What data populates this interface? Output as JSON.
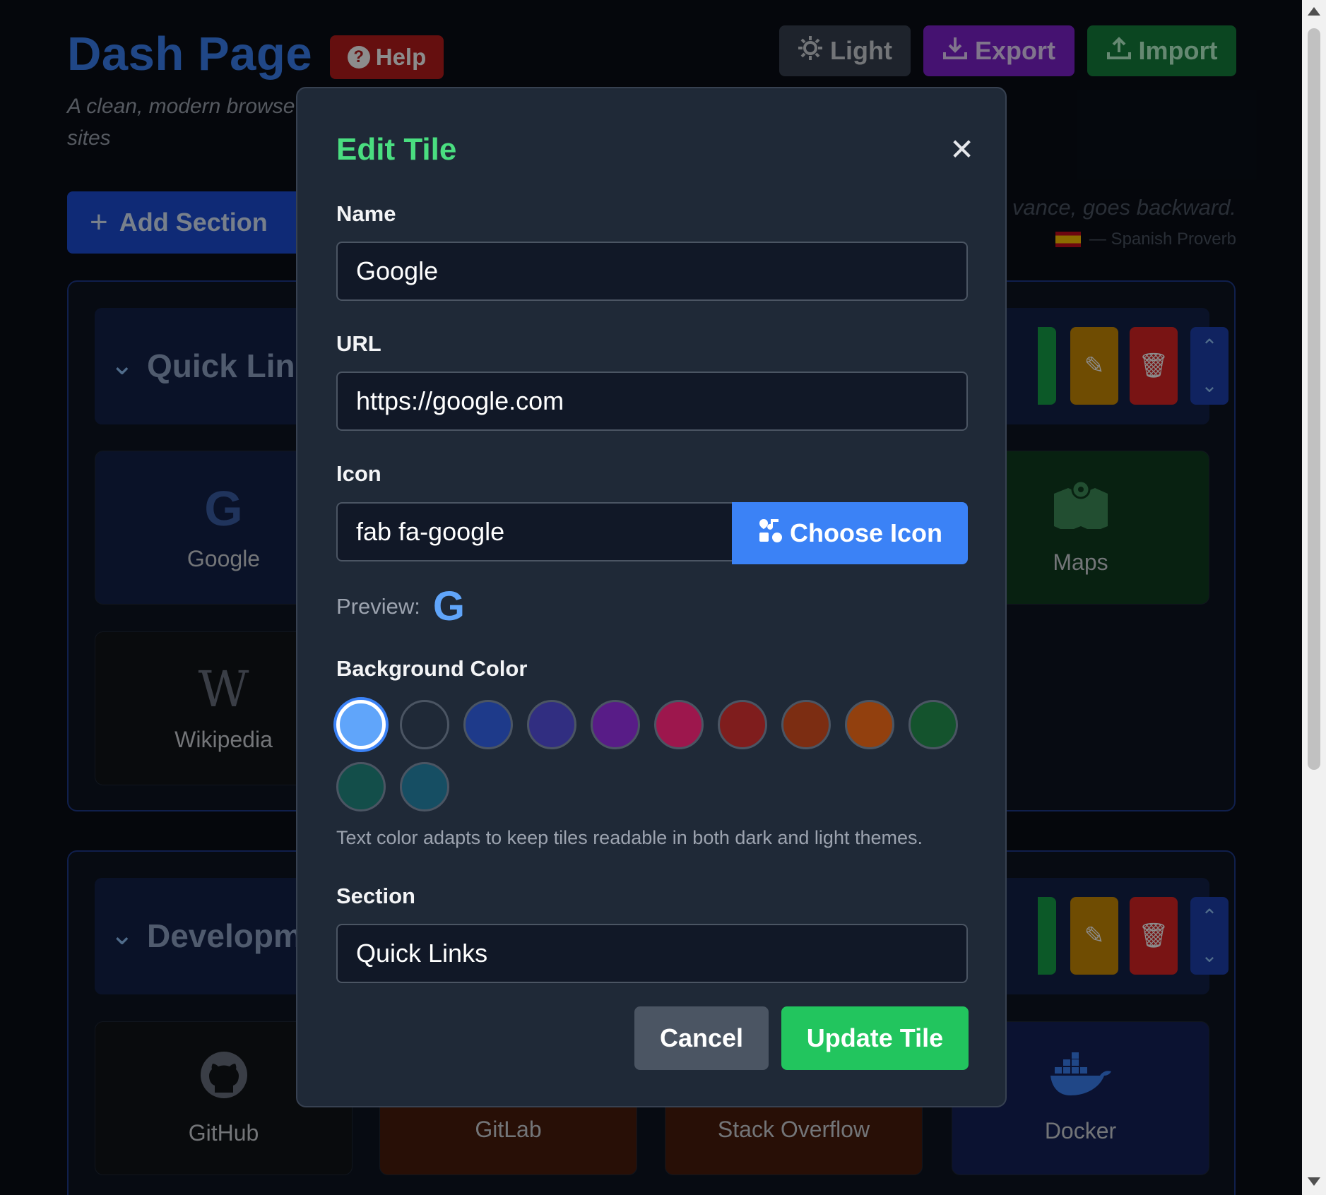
{
  "header": {
    "title": "Dash Page",
    "help_label": "Help",
    "subtitle": "A clean, modern browse",
    "subtitle2": "sites",
    "light_label": "Light",
    "export_label": "Export",
    "import_label": "Import"
  },
  "add_section_label": "Add Section",
  "quote": {
    "text": "vance, goes backward.",
    "author": "— Spanish Proverb"
  },
  "sections": [
    {
      "name": "Quick Lin",
      "tiles": [
        {
          "label": "Google",
          "icon": "google-icon"
        },
        {
          "label": "Maps",
          "icon": "map-icon"
        },
        {
          "label": "Wikipedia",
          "icon": "wikipedia-icon"
        }
      ]
    },
    {
      "name": "Developm",
      "tiles": [
        {
          "label": "GitHub",
          "icon": "github-icon"
        },
        {
          "label": "GitLab",
          "icon": "gitlab-icon"
        },
        {
          "label": "Stack Overflow",
          "icon": "stackoverflow-icon"
        },
        {
          "label": "Docker",
          "icon": "docker-icon"
        }
      ]
    }
  ],
  "modal": {
    "title": "Edit Tile",
    "name_label": "Name",
    "name_value": "Google",
    "url_label": "URL",
    "url_value": "https://google.com",
    "icon_label": "Icon",
    "icon_value": "fab fa-google",
    "choose_icon_label": "Choose Icon",
    "preview_label": "Preview:",
    "bg_label": "Background Color",
    "colors": [
      "#60a5fa",
      "#1f2937",
      "#1e3a8a",
      "#312e81",
      "#581c87",
      "#9d174d",
      "#7f1d1d",
      "#7c2d12",
      "#92400e",
      "#14532d",
      "#134e4a",
      "#164e63"
    ],
    "selected_color_index": 0,
    "hint": "Text color adapts to keep tiles readable in both dark and light themes.",
    "section_label": "Section",
    "section_value": "Quick Links",
    "cancel_label": "Cancel",
    "update_label": "Update Tile"
  }
}
